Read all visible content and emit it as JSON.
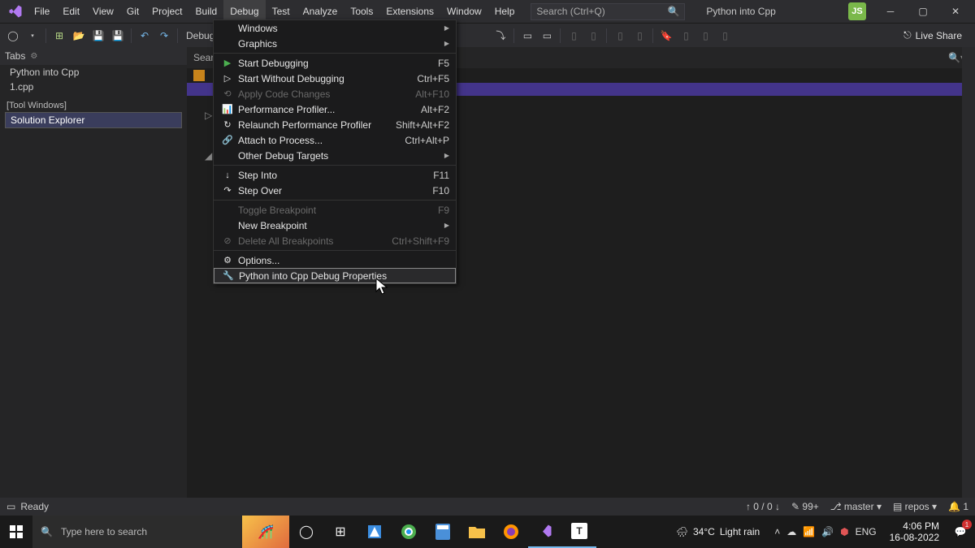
{
  "titlebar": {
    "menus": [
      "File",
      "Edit",
      "View",
      "Git",
      "Project",
      "Build",
      "Debug",
      "Test",
      "Analyze",
      "Tools",
      "Extensions",
      "Window",
      "Help"
    ],
    "active_menu": "Debug",
    "search_placeholder": "Search (Ctrl+Q)",
    "project": "Python into Cpp",
    "user": "JS"
  },
  "toolbar": {
    "config": "Debug",
    "liveshare": "Live Share"
  },
  "sidebar": {
    "tabs_title": "Tabs",
    "open_tabs": [
      "Python into Cpp",
      "1.cpp"
    ],
    "tool_windows_header": "[Tool Windows]",
    "active": "Solution Explorer"
  },
  "editor": {
    "search_placeholder": "Search"
  },
  "debug_menu": [
    {
      "label": "Windows",
      "arrow": true
    },
    {
      "label": "Graphics",
      "arrow": true
    },
    {
      "sep": true
    },
    {
      "icon": "play-green",
      "label": "Start Debugging",
      "shortcut": "F5"
    },
    {
      "icon": "play-outline",
      "label": "Start Without Debugging",
      "shortcut": "Ctrl+F5"
    },
    {
      "icon": "apply",
      "label": "Apply Code Changes",
      "shortcut": "Alt+F10",
      "disabled": true
    },
    {
      "icon": "perf",
      "label": "Performance Profiler...",
      "shortcut": "Alt+F2"
    },
    {
      "icon": "relaunch",
      "label": "Relaunch Performance Profiler",
      "shortcut": "Shift+Alt+F2"
    },
    {
      "icon": "attach",
      "label": "Attach to Process...",
      "shortcut": "Ctrl+Alt+P"
    },
    {
      "label": "Other Debug Targets",
      "arrow": true
    },
    {
      "sep": true
    },
    {
      "icon": "stepinto",
      "label": "Step Into",
      "shortcut": "F11"
    },
    {
      "icon": "stepover",
      "label": "Step Over",
      "shortcut": "F10"
    },
    {
      "sep": true
    },
    {
      "label": "Toggle Breakpoint",
      "shortcut": "F9",
      "disabled": true
    },
    {
      "label": "New Breakpoint",
      "arrow": true
    },
    {
      "icon": "delete",
      "label": "Delete All Breakpoints",
      "shortcut": "Ctrl+Shift+F9",
      "disabled": true
    },
    {
      "sep": true
    },
    {
      "icon": "gear",
      "label": "Options..."
    },
    {
      "icon": "wrench",
      "label": "Python into Cpp Debug Properties",
      "highlight": true
    }
  ],
  "status": {
    "ready": "Ready",
    "updown": "↑ 0 / 0 ↓",
    "changes": "99+",
    "branch": "master",
    "repo": "repos",
    "notif": "1"
  },
  "taskbar": {
    "search_placeholder": "Type here to search",
    "weather_temp": "34°C",
    "weather_desc": "Light rain",
    "lang": "ENG",
    "time": "4:06 PM",
    "date": "16-08-2022",
    "notif_count": "1"
  }
}
